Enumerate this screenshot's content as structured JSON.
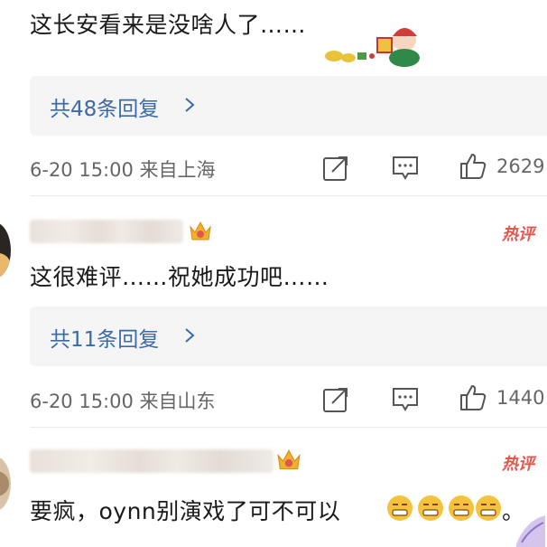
{
  "comments": [
    {
      "text": "这长安看来是没啥人了……",
      "reply_label": "共48条回复",
      "meta": "6-20 15:00 来自上海",
      "like_count": "2629"
    },
    {
      "badge": "热评",
      "text": "这很难评……祝她成功吧……",
      "reply_label": "共11条回复",
      "meta": "6-20 15:00 来自山东",
      "like_count": "1440"
    },
    {
      "badge": "热评",
      "text": "要疯，oynn别演戏了可不可以",
      "text_suffix": "。"
    }
  ],
  "icons": {
    "share": "share-icon",
    "comment": "comment-icon",
    "like": "thumbs-up-icon",
    "crown": "crown-badge-icon",
    "emoji": "grimace-emoji-icon"
  },
  "colors": {
    "link": "#3b6aa8",
    "meta": "#666666",
    "hot": "#e0574f",
    "reply_bg": "#f5f5f5"
  }
}
